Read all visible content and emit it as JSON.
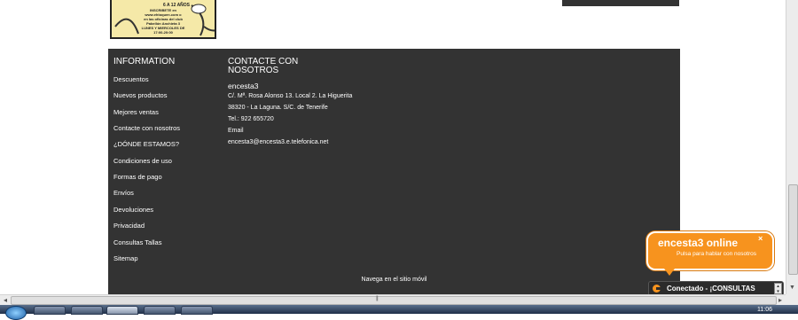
{
  "ad": {
    "lines": [
      "INSCRIBETE en",
      "www.ehtoquen.com o",
      "en las oficinas del club",
      "Pabellón Anchieta 3",
      "LUNES Y MIERCOLES DE",
      "17:00-20:00"
    ],
    "age_text": "6 A 12 AÑOS"
  },
  "footer": {
    "info_title": "INFORMATION",
    "menu": [
      "Descuentos",
      "Nuevos productos",
      "Mejores ventas",
      "Contacte con nosotros",
      "¿DÓNDE ESTAMOS?",
      "Condiciones de uso",
      "Formas de pago",
      "Envíos",
      "Devoluciones",
      "Privacidad",
      "Consultas Tallas",
      "Sitemap"
    ],
    "contact_title": "CONTACTE CON NOSOTROS",
    "company": "encesta3",
    "address1": "C/. Mª. Rosa Alonso 13. Local 2. La Higuerita",
    "address2": "38320 - La Laguna.  S/C. de Tenerife",
    "phone": "Tel.: 922 655720",
    "email_label": "Email",
    "email": "encesta3@encesta3.e.telefonica.net",
    "mobile_link": "Navega en el sitio móvil"
  },
  "chat": {
    "title": "encesta3 online",
    "subtitle": "Pulsa para hablar con nosotros",
    "close": "×",
    "status": "Conectado - ¡CONSULTAS"
  },
  "taskbar": {
    "clock": "11:06"
  },
  "colors": {
    "footer_bg": "#333333",
    "chat_accent": "#f7931e"
  }
}
